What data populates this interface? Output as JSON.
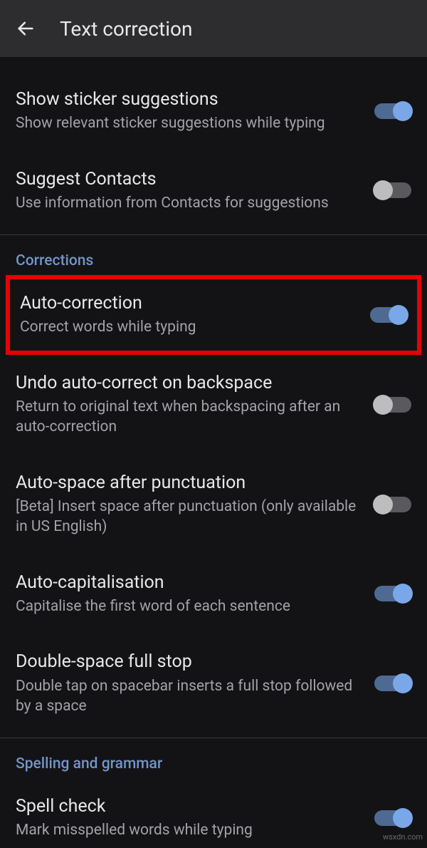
{
  "header": {
    "title": "Text correction"
  },
  "settings": {
    "sticker": {
      "title": "Show sticker suggestions",
      "subtitle": "Show relevant sticker suggestions while typing",
      "on": true
    },
    "contacts": {
      "title": "Suggest Contacts",
      "subtitle": "Use information from Contacts for suggestions",
      "on": false
    },
    "autocorrect": {
      "title": "Auto-correction",
      "subtitle": "Correct words while typing",
      "on": true
    },
    "undo": {
      "title": "Undo auto-correct on backspace",
      "subtitle": "Return to original text when backspacing after an auto-correction",
      "on": false
    },
    "autospace": {
      "title": "Auto-space after punctuation",
      "subtitle": "[Beta] Insert space after punctuation (only available in US English)",
      "on": false
    },
    "autocap": {
      "title": "Auto-capitalisation",
      "subtitle": "Capitalise the first word of each sentence",
      "on": true
    },
    "doublespace": {
      "title": "Double-space full stop",
      "subtitle": "Double tap on spacebar inserts a full stop followed by a space",
      "on": true
    },
    "spellcheck": {
      "title": "Spell check",
      "subtitle": "Mark misspelled words while typing",
      "on": true
    }
  },
  "sections": {
    "corrections": "Corrections",
    "spelling": "Spelling and grammar"
  },
  "watermark": "wsxdn.com"
}
